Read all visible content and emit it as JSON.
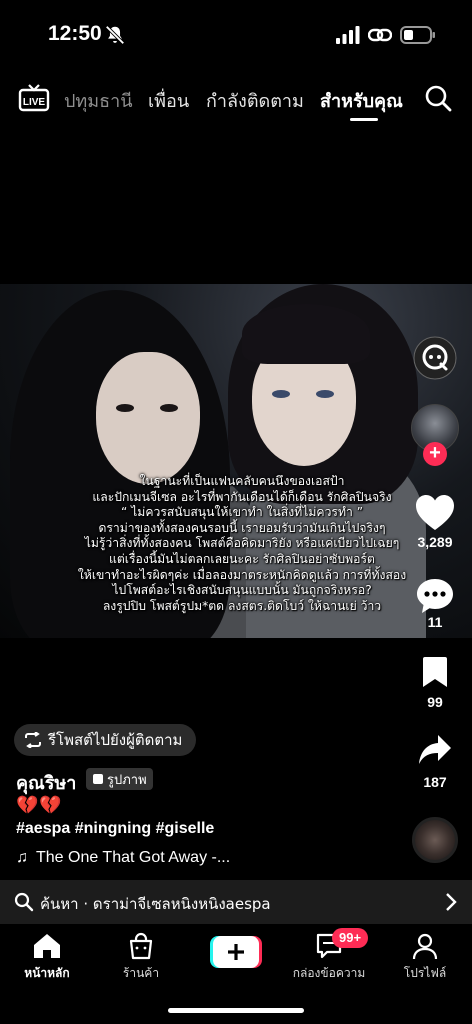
{
  "status_bar": {
    "time": "12:50",
    "icons": [
      "bell-muted-icon",
      "signal-icon",
      "link-icon",
      "battery-icon"
    ]
  },
  "top_nav": {
    "live_label": "LIVE",
    "tabs": [
      {
        "label": "ปทุมธานี"
      },
      {
        "label": "เพื่อน"
      },
      {
        "label": "กำลังติดตาม"
      },
      {
        "label": "สำหรับคุณ"
      }
    ],
    "active_tab": "สำหรับคุณ"
  },
  "post": {
    "caption_lines": [
      "ในฐานะที่เป็นแฟนคลับคนนึงของเอสป้า",
      "และปักเมนจีเซล อะไรที่พากันเดือนได้ก็เดือน รักศิลปินจริง",
      "“ ไม่ควรสนับสนุนให้เขาทำ ในสิ่งที่ไม่ควรทำ ”",
      "ดราม่าของทั้งสองคนรอบนี้ เรายอมรับว่ามันเกินไปจริงๆ",
      "ไม่รู้ว่าสิ่งที่ทั้งสองคน โพสต์คือคิดมาริยัง หรือแค่เบียวไปเฉยๆ",
      "แต่เรื่องนี้มันไม่ตลกเลยนะคะ รักศิลปินอย่าซับพอร์ต",
      "ให้เขาทำอะไรผิดๆค่ะ เมื่อลองมาตระหนักคิดดูแล้ว การที่ทั้งสอง",
      "ไปโพสต์อะไรเชิงสนับสนุนแบบนั้น มันถูกจริงหรอ?",
      "ลงรูปปิบ โพสต์รูปม*ตด ลงสตร.ติดโบว์ ให้ฉานเย่ ว้าว"
    ],
    "likes": "3,289",
    "comments": "11",
    "saves": "99",
    "shares": "187",
    "repost_label": "รีโพสต์ไปยังผู้ติดตาม",
    "author": "คุณริษา",
    "badge_label": "รูปภาพ",
    "emojis": "💔💔",
    "hashtags": "#aespa #ningning #giselle",
    "music": "The One That Got Away -..."
  },
  "search_strip": {
    "text": "ค้นหา · ดราม่าจีเซลหนิงหนิงaespa"
  },
  "tab_bar": {
    "items": [
      {
        "label": "หน้าหลัก"
      },
      {
        "label": "ร้านค้า"
      },
      {
        "label": ""
      },
      {
        "label": "กล่องข้อความ"
      },
      {
        "label": "โปรไฟล์"
      }
    ],
    "inbox_badge": "99+"
  },
  "colors": {
    "accent": "#fe2c55",
    "create_left": "#25f4ee",
    "create_right": "#fe2c55"
  }
}
